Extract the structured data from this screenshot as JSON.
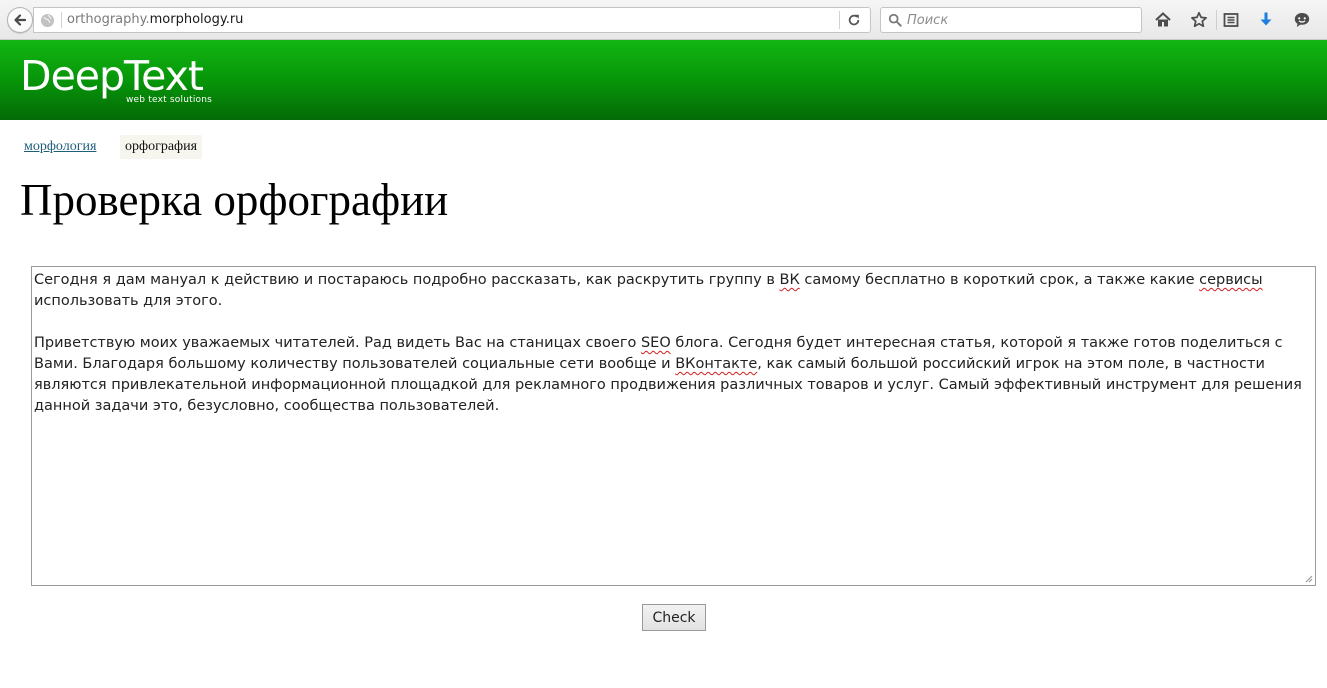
{
  "browser": {
    "url_prefix": "orthography.",
    "url_domain": "morphology.ru",
    "search_placeholder": "Поиск"
  },
  "banner": {
    "logo_text": "DeepText",
    "logo_tagline": "web text solutions",
    "brand_color": "#0a9e0c"
  },
  "breadcrumb": {
    "link_label": "морфология",
    "current_label": "орфография"
  },
  "page": {
    "title": "Проверка орфографии"
  },
  "editor": {
    "paragraph1": [
      {
        "text": "Сегодня я дам мануал к действию и постараюсь подробно рассказать, как раскрутить группу в ",
        "err": false
      },
      {
        "text": "ВК",
        "err": true
      },
      {
        "text": " самому бесплатно в короткий срок, а также какие ",
        "err": false
      },
      {
        "text": "сервисы",
        "err": true
      },
      {
        "text": " использовать для этого.",
        "err": false
      }
    ],
    "paragraph2": [
      {
        "text": "Приветствую моих уважаемых читателей. Рад видеть Вас на станицах своего ",
        "err": false
      },
      {
        "text": "SEO",
        "err": true
      },
      {
        "text": " блога. Сегодня будет интересная статья, которой я также готов поделиться с Вами. Благодаря большому количеству пользователей социальные сети вообще и ",
        "err": false
      },
      {
        "text": "ВКонтакте",
        "err": true
      },
      {
        "text": ", как самый большой российский игрок на этом поле, в частности являются привлекательной информационной площадкой для рекламного продвижения различных товаров и услуг. Самый эффективный инструмент для решения данной задачи это, безусловно, сообщества пользователей.",
        "err": false
      }
    ]
  },
  "actions": {
    "check_label": "Check"
  }
}
